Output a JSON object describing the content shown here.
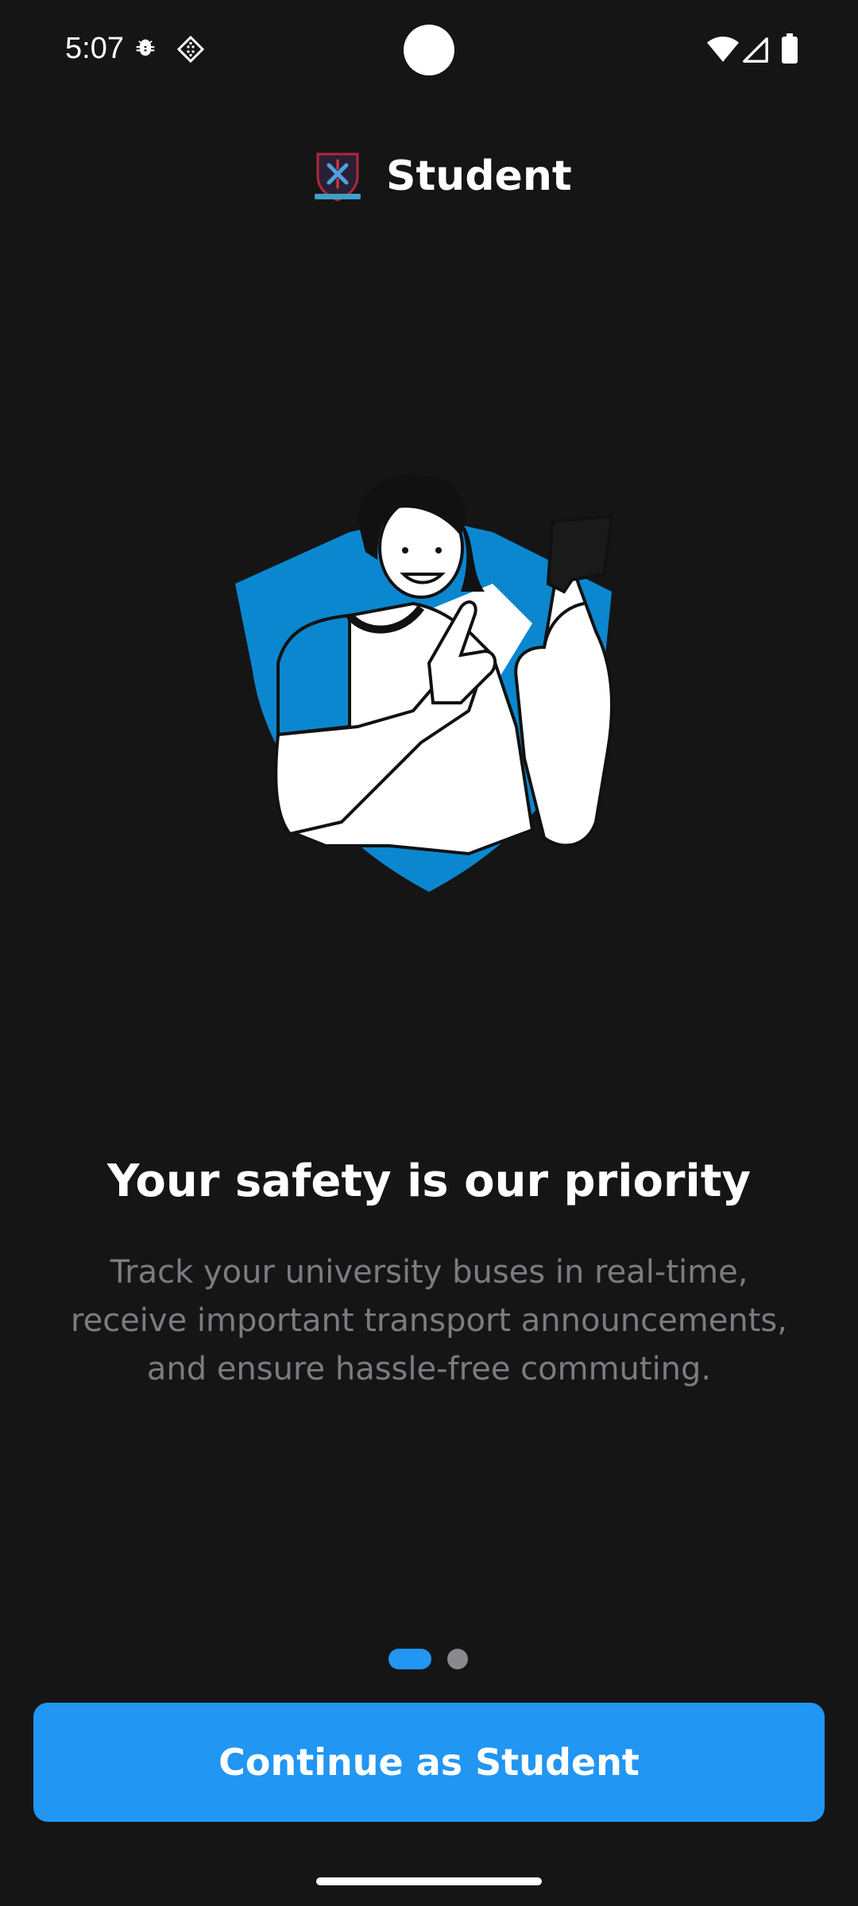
{
  "status_bar": {
    "time": "5:07",
    "left_icons": [
      "bug-icon",
      "diamond-grid-icon"
    ],
    "right_icons": [
      "wifi-icon",
      "cellular-signal-icon",
      "battery-icon"
    ]
  },
  "header": {
    "title": "Student",
    "logo_icon": "university-crest-icon"
  },
  "onboarding": {
    "headline": "Your safety is our priority",
    "body": "Track your university buses in real-time, receive important transport announcements, and ensure hassle-free commuting.",
    "page_count": 2,
    "current_page": 1
  },
  "cta": {
    "label": "Continue as Student"
  },
  "colors": {
    "background": "#151516",
    "accent": "#2196f3",
    "body_text": "#7c7c80",
    "inactive_dot": "#8a8a8e",
    "shield": "#0b87cf"
  }
}
